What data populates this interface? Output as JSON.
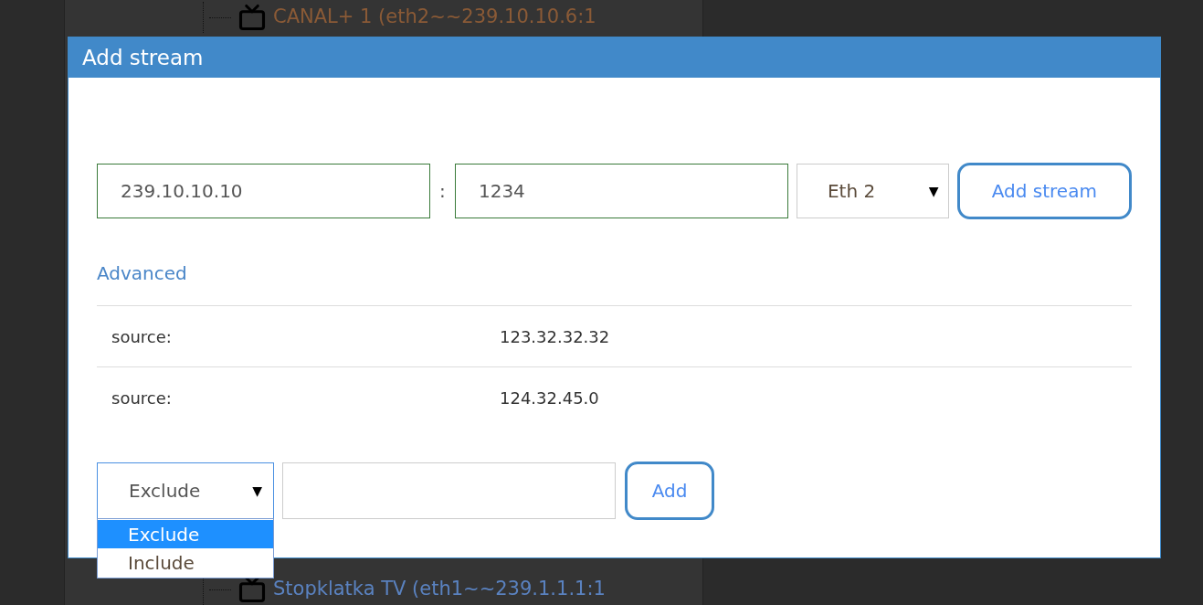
{
  "background_tree": [
    {
      "label": "CANAL+ 1 (eth2~~239.10.10.6:1",
      "color": "#8a5a36"
    },
    {
      "label": "Stopklatka TV (eth1~~239.1.1.1:1",
      "color": "#5a82c0"
    }
  ],
  "dialog": {
    "title": "Add stream",
    "address": {
      "value": "239.10.10.10"
    },
    "separator": ":",
    "port": {
      "value": "1234"
    },
    "interface": {
      "value": "Eth 2",
      "arrow": "▼"
    },
    "add_button": "Add stream",
    "advanced_link": "Advanced",
    "sources": [
      {
        "label": "source:",
        "value": "123.32.32.32"
      },
      {
        "label": "source:",
        "value": "124.32.45.0"
      }
    ],
    "filter": {
      "mode": {
        "value": "Exclude",
        "arrow": "▼",
        "open": true,
        "options": [
          {
            "label": "Exclude",
            "selected": true
          },
          {
            "label": "Include",
            "selected": false
          }
        ]
      },
      "add_button": "Add"
    }
  }
}
